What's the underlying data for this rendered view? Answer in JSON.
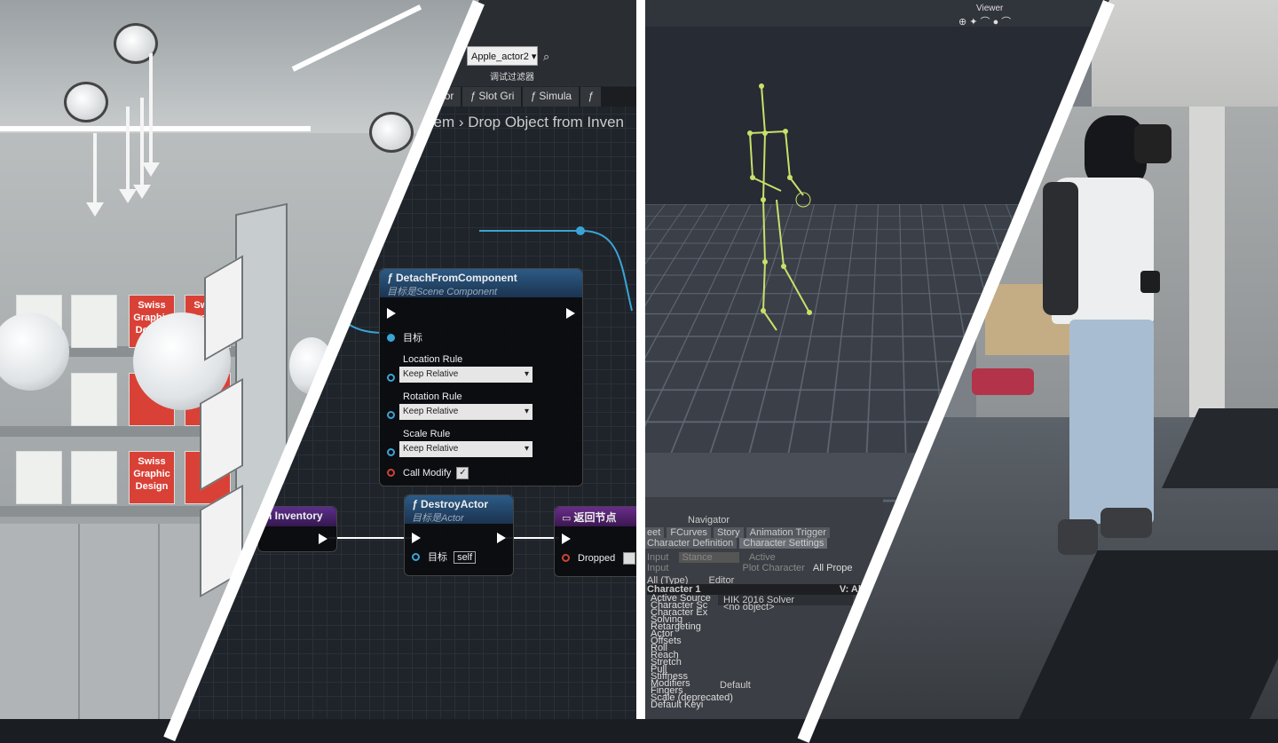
{
  "blueprint": {
    "actor_dropdown": "Apple_actor2",
    "filter_label": "调试过滤器",
    "tabs": [
      "elepor",
      "Slot Gri",
      "Simula"
    ],
    "breadcrumb_left": "item",
    "breadcrumb_right": "Drop Object from Inven",
    "detach_node": {
      "title": "DetachFromComponent",
      "subtitle": "目标是Scene Component",
      "target_label": "目标",
      "location_rule_label": "Location Rule",
      "location_rule_value": "Keep Relative",
      "rotation_rule_label": "Rotation Rule",
      "rotation_rule_value": "Keep Relative",
      "scale_rule_label": "Scale Rule",
      "scale_rule_value": "Keep Relative",
      "call_modify_label": "Call Modify"
    },
    "destroy_node": {
      "title": "DestroyActor",
      "subtitle": "目标是Actor",
      "target_label": "目标",
      "self_label": "self"
    },
    "inventory_node": {
      "title": "n Inventory"
    },
    "return_node": {
      "title": "返回节点",
      "dropped_label": "Dropped"
    }
  },
  "store": {
    "book_text": [
      "Swiss",
      "Graphic",
      "Design"
    ]
  },
  "mocap": {
    "viewer_label": "Viewer",
    "navigator_label": "Navigator",
    "tabs_row1": [
      "eet",
      "FCurves",
      "Story",
      "Animation Trigger"
    ],
    "tabs_row2": [
      "Character Definition",
      "Character Settings"
    ],
    "input_label": "Input",
    "stance_label": "Stance",
    "active_label": "Active",
    "plot_character_label": "Plot Character",
    "all_props_label": "All Prope",
    "type_filter": "All (Type)",
    "editor_label": "Editor",
    "character_label": "Character 1",
    "view_all_label": "V: All",
    "solver_value": "HIK 2016 Solver",
    "no_object_value": "<no object>",
    "tree_items": [
      "Active Source",
      "Character Sc",
      "Character Ex",
      "Solving",
      "Retargeting",
      "Actor",
      "Offsets",
      "Roll",
      "Reach",
      "Stretch",
      "Pull",
      "Stiffness",
      "Modifiers",
      "Fingers",
      "Scale (deprecated)",
      "Default Keyi"
    ],
    "default_value": "Default"
  },
  "colors": {
    "blueprint_wire": "#3aa4d6",
    "node_header_blue": "#2c5b86",
    "node_header_purple": "#6a2c8a",
    "skeleton": "#c9e06a",
    "book_red": "#d94136"
  }
}
